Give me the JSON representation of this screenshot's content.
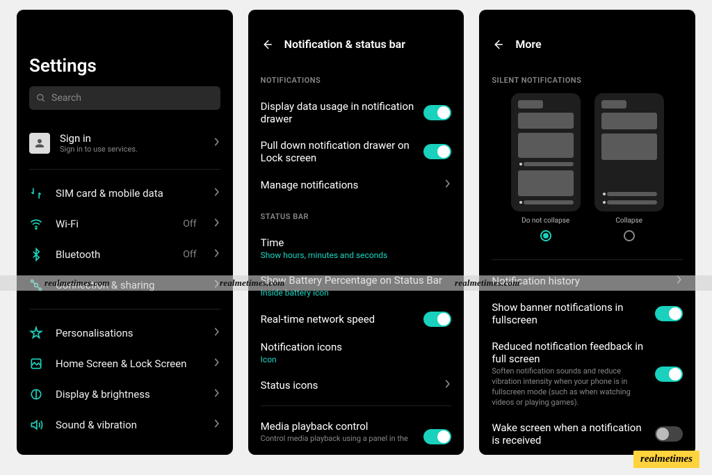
{
  "watermark_text": "realmetimes.com",
  "badge_text": "realmetimes",
  "phone1": {
    "title": "Settings",
    "search_placeholder": "Search",
    "signin_title": "Sign in",
    "signin_sub": "Sign in to use services.",
    "rows": {
      "sim": "SIM card & mobile data",
      "wifi": "Wi-Fi",
      "wifi_state": "Off",
      "bluetooth": "Bluetooth",
      "bluetooth_state": "Off",
      "connection": "Connection & sharing",
      "personalisations": "Personalisations",
      "homescreen": "Home Screen & Lock Screen",
      "display": "Display & brightness",
      "sound": "Sound & vibration"
    }
  },
  "phone2": {
    "title": "Notification & status bar",
    "section_notifications": "NOTIFICATIONS",
    "data_usage": "Display data usage in notification drawer",
    "pull_down": "Pull down notification drawer on Lock screen",
    "manage": "Manage notifications",
    "section_statusbar": "STATUS BAR",
    "time_label": "Time",
    "time_sub": "Show hours, minutes and seconds",
    "battery_label": "Show Battery Percentage on Status Bar",
    "battery_sub": "Inside battery icon",
    "network_speed": "Real-time network speed",
    "notif_icons": "Notification icons",
    "notif_icons_sub": "Icon",
    "status_icons": "Status icons",
    "media_control": "Media playback control",
    "media_control_sub": "Control media playback using a panel in the"
  },
  "phone3": {
    "title": "More",
    "section_silent": "SILENT NOTIFICATIONS",
    "preview1_label": "Do not collapse",
    "preview2_label": "Collapse",
    "history": "Notification history",
    "banner": "Show banner notifications in fullscreen",
    "reduced": "Reduced notification feedback in full screen",
    "reduced_sub": "Soften notification sounds and reduce vibration intensity when your phone is in fullscreen mode (such as when watching videos or playing games).",
    "wake": "Wake screen when a notification is received"
  }
}
